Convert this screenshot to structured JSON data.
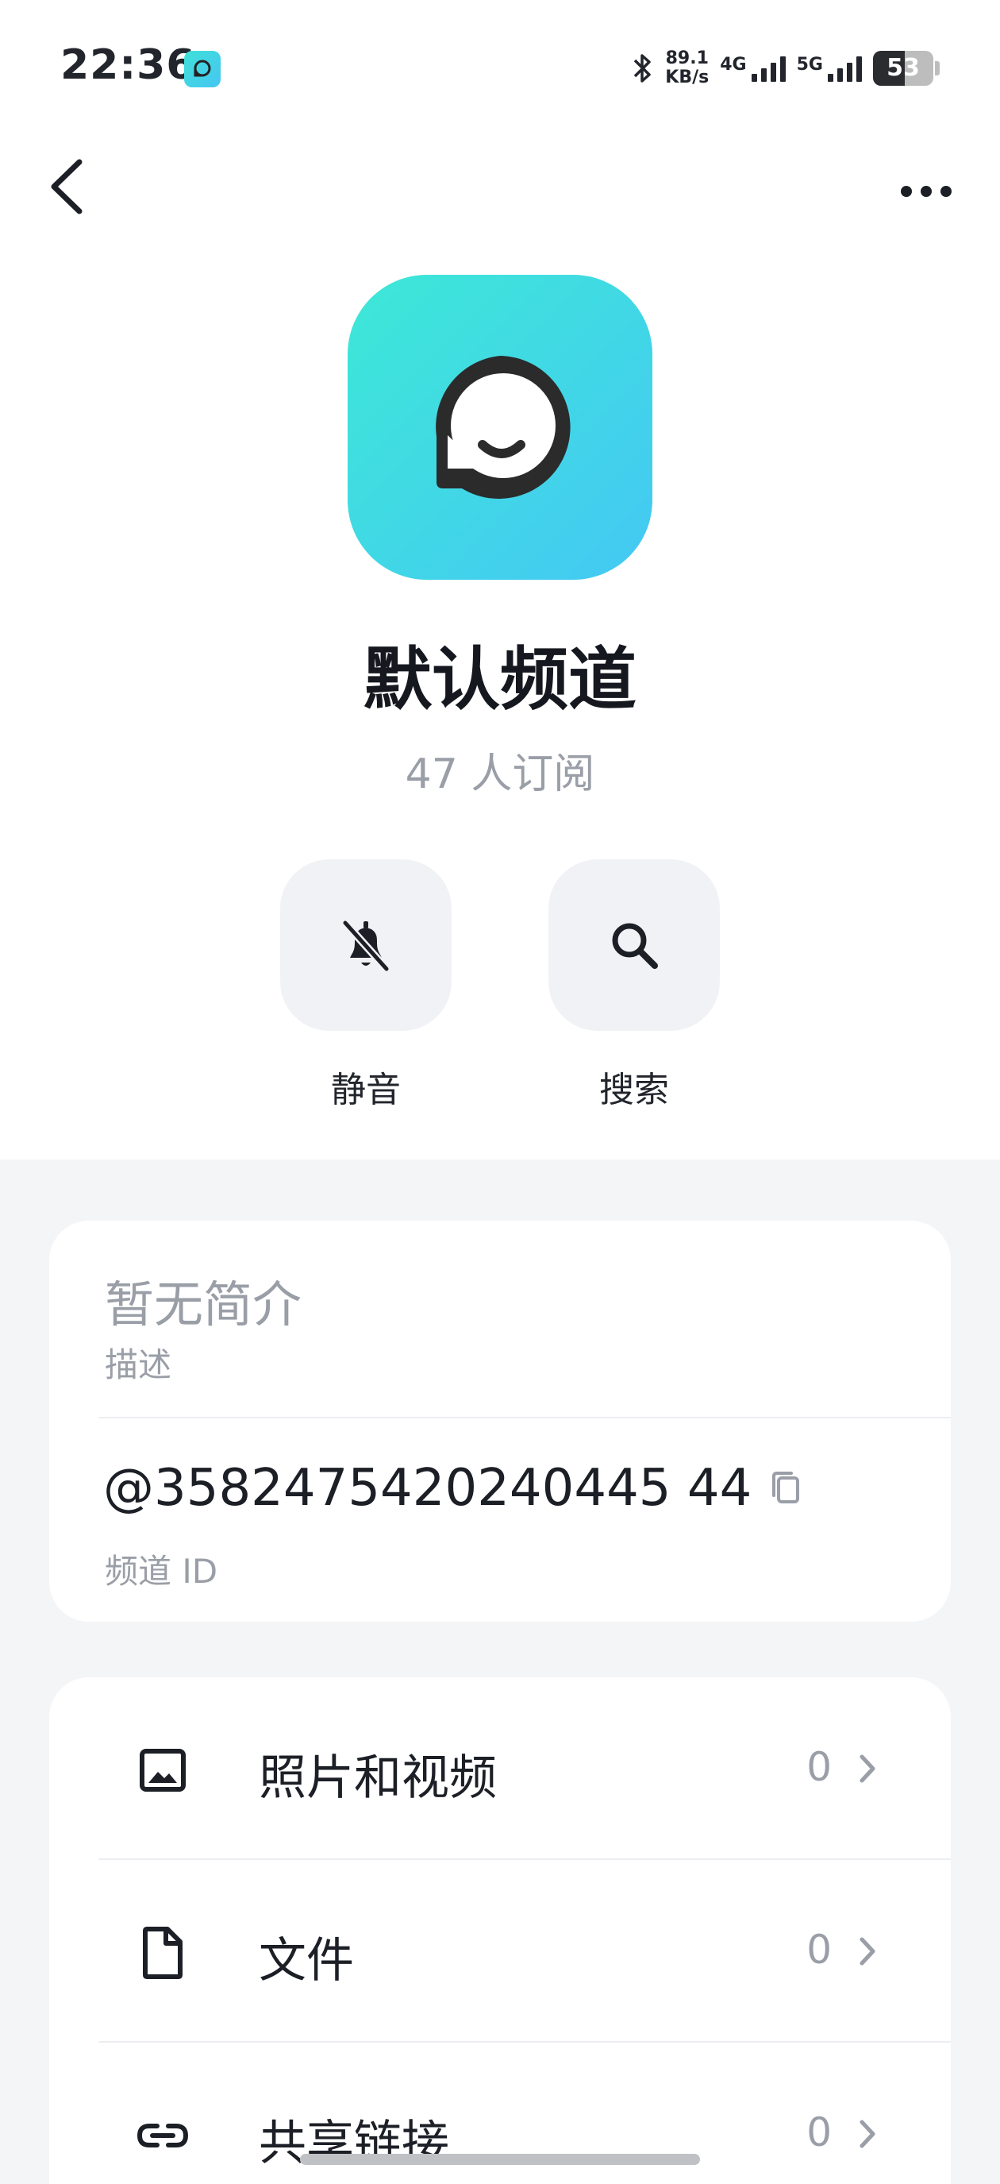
{
  "status_bar": {
    "time": "22:36",
    "net_speed_value": "89.1",
    "net_speed_unit": "KB/s",
    "signal_1": "4G",
    "signal_2": "5G",
    "battery": "53"
  },
  "header": {
    "back_icon": "chevron-left-icon",
    "more_icon": "more-horizontal-icon"
  },
  "channel": {
    "name": "默认频道",
    "subscribers": "47 人订阅"
  },
  "actions": [
    {
      "label": "静音",
      "icon": "bell-off-icon"
    },
    {
      "label": "搜索",
      "icon": "search-icon"
    }
  ],
  "info_card": {
    "intro_value": "暂无简介",
    "intro_label": "描述",
    "id_value": "@3582475420240445 44",
    "id_label": "频道 ID"
  },
  "media_list": [
    {
      "label": "照片和视频",
      "count": "0",
      "icon": "image-icon"
    },
    {
      "label": "文件",
      "count": "0",
      "icon": "file-icon"
    },
    {
      "label": "共享链接",
      "count": "0",
      "icon": "link-icon"
    }
  ],
  "colors": {
    "accent_gradient_start": "#3de8d6",
    "accent_gradient_end": "#44c8f4",
    "muted_text": "#9a9ea7",
    "section_bg": "#f4f5f7"
  }
}
